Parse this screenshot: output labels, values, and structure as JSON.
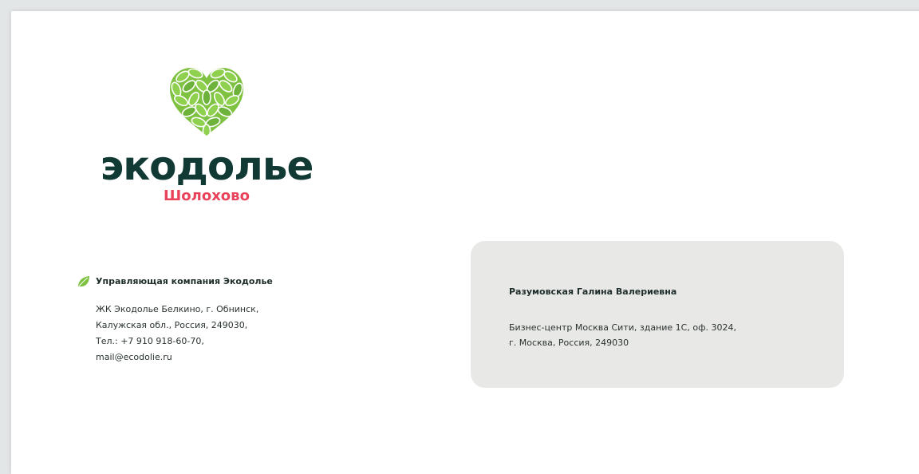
{
  "logo": {
    "brand": "экодолье",
    "location": "Шолохово",
    "heart_icon": "leaf-heart-icon",
    "colors": {
      "brand": "#123a35",
      "location": "#e8435a",
      "leaf_light": "#8ccf4a",
      "leaf_dark": "#5aa630"
    }
  },
  "sender": {
    "icon": "leaf-icon",
    "company": "Управляющая компания Экодолье",
    "lines": [
      "ЖК Экодолье Белкино, г. Обнинск,",
      "Калужская обл., Россия, 249030,",
      "Тел.: +7 910 918-60-70,",
      "mail@ecodolie.ru"
    ]
  },
  "recipient": {
    "name": "Разумовская Галина Валериевна",
    "lines": [
      "Бизнес-центр Москва Сити, здание 1С, оф. 3024,",
      "г. Москва, Россия, 249030"
    ],
    "box_color": "#e8e8e7"
  }
}
